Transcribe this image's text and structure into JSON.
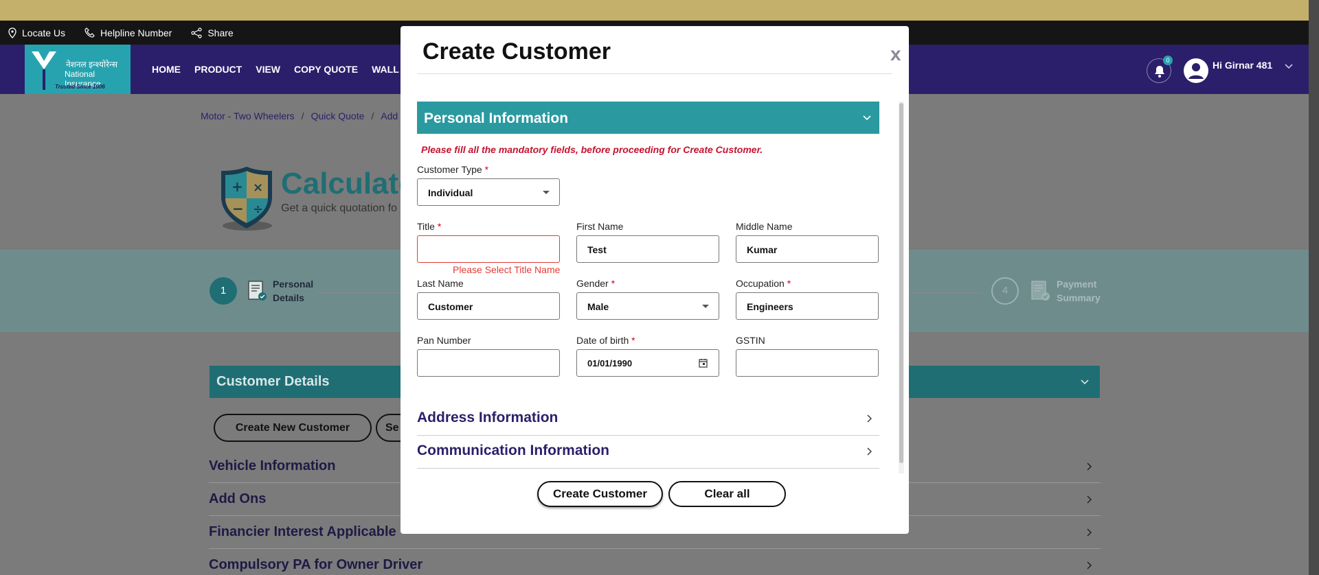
{
  "top_bar": {
    "locate_us": "Locate Us",
    "helpline": "Helpline Number",
    "share": "Share"
  },
  "brand": {
    "name_hindi": "नेशनल इन्श्योरेन्स",
    "name_en": "National Insurance",
    "tagline": "Trusted Since 1906"
  },
  "nav": {
    "items": [
      "HOME",
      "PRODUCT",
      "VIEW",
      "COPY QUOTE",
      "WALL"
    ]
  },
  "notifications": {
    "count": "0"
  },
  "user": {
    "greeting": "Hi Girnar 481"
  },
  "breadcrumb": [
    "Motor - Two Wheelers",
    "Quick Quote",
    "Add"
  ],
  "hero": {
    "title": "Calculate",
    "subtitle": "Get a quick quotation fo"
  },
  "stepper": {
    "step1_num": "1",
    "step1_line1": "Personal",
    "step1_line2": "Details",
    "step4_num": "4",
    "step4_line1": "Payment",
    "step4_line2": "Summary"
  },
  "customer_details": {
    "header": "Customer Details",
    "create_new": "Create New Customer",
    "search_partial": "Se"
  },
  "accordion": [
    "Vehicle Information",
    "Add Ons",
    "Financier Interest Applicable",
    "Compulsory PA for Owner Driver"
  ],
  "modal": {
    "title": "Create Customer",
    "close": "x",
    "personal_header": "Personal Information",
    "warning": "Please fill all the mandatory fields, before proceeding for Create Customer.",
    "fields": {
      "customer_type": {
        "label": "Customer Type",
        "value": "Individual"
      },
      "title": {
        "label": "Title",
        "value": "",
        "error": "Please Select Title Name"
      },
      "first_name": {
        "label": "First Name",
        "value": "Test"
      },
      "middle_name": {
        "label": "Middle Name",
        "value": "Kumar"
      },
      "last_name": {
        "label": "Last Name",
        "value": "Customer"
      },
      "gender": {
        "label": "Gender",
        "value": "Male"
      },
      "occupation": {
        "label": "Occupation",
        "value": "Engineers"
      },
      "pan": {
        "label": "Pan Number",
        "value": ""
      },
      "dob": {
        "label": "Date of birth",
        "value": "01/01/1990"
      },
      "gstin": {
        "label": "GSTIN",
        "value": ""
      }
    },
    "address_header": "Address Information",
    "communication_header": "Communication Information",
    "create_button": "Create Customer",
    "clear_button": "Clear all"
  }
}
